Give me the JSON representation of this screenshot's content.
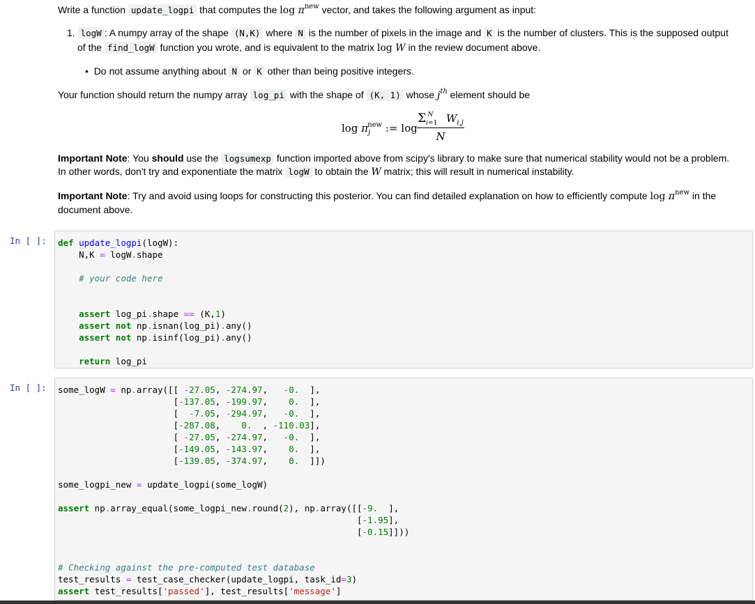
{
  "intro": {
    "a": "Write a function",
    "fn": "update_logpi",
    "b": "that computes the",
    "c": "vector, and takes the following argument as input:"
  },
  "args": {
    "number": "1.",
    "name": "logW",
    "a": ": A numpy array of the shape",
    "shape": "(N,K)",
    "b": "where",
    "n": "N",
    "c": "is the number of pixels in the image and",
    "k": "K",
    "d": "is the number of clusters. This is the supposed output",
    "e": "of the",
    "fn": "find_logW",
    "f": "function you wrote, and is equivalent to the matrix",
    "g": "in the review document above."
  },
  "bullet": {
    "a": "Do not assume anything about",
    "n": "N",
    "or": "or",
    "k": "K",
    "b": "other than being positive integers."
  },
  "returns": {
    "a": "Your function should return the numpy array",
    "name": "log_pi",
    "b": "with the shape of",
    "shape": "(K, 1)",
    "c": "whose",
    "d": "element should be"
  },
  "note1": {
    "label": "Important Note",
    "a": ": You",
    "strong": "should",
    "b": "use the",
    "fn": "logsumexp",
    "c": "function imported above from scipy's library to make sure that numerical stability would not be a problem.",
    "d": "In other words, don't try and exponentiate the matrix",
    "var": "logW",
    "e": "to obtain the",
    "f": "matrix; this will result in numerical instability."
  },
  "note2": {
    "label": "Important Note",
    "a": ": Try and avoid using loops for constructing this posterior. You can find detailed explanation on how to efficiently compute",
    "b": "in the",
    "c": "document above."
  },
  "cells": [
    {
      "prompt": "In [ ]:"
    },
    {
      "prompt": "In [ ]:"
    }
  ]
}
